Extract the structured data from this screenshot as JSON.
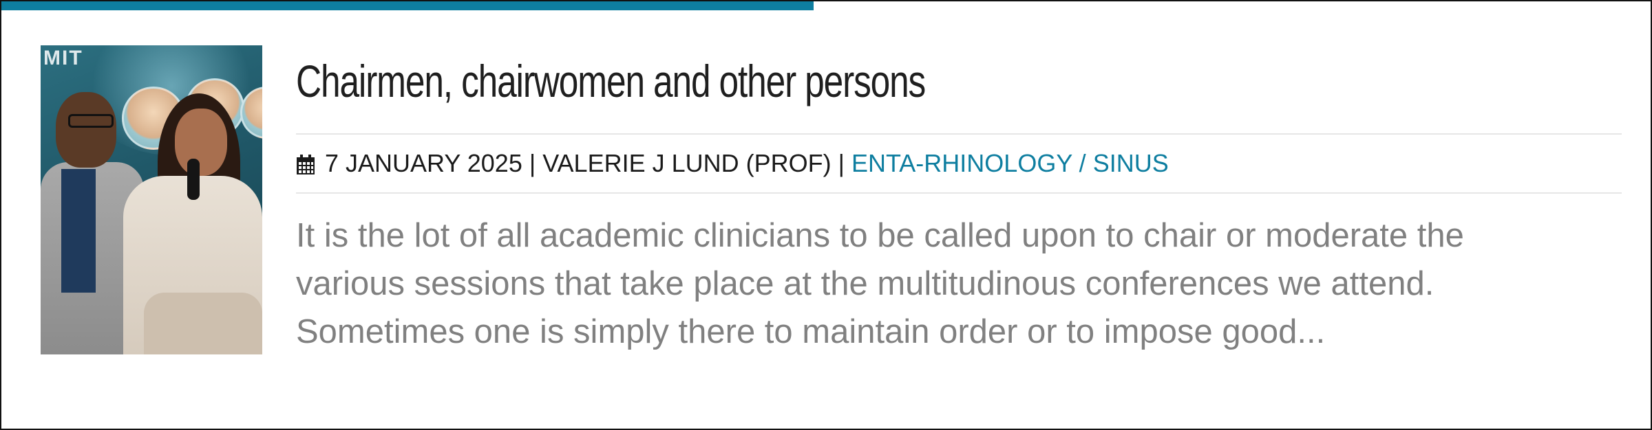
{
  "article": {
    "title": "Chairmen, chairwomen and other persons",
    "date": "7 JANUARY 2025",
    "author": "VALERIE J LUND (PROF)",
    "separator": "|",
    "category": "ENTA-RHINOLOGY / SINUS",
    "excerpt_lines": [
      "It is the lot of all academic clinicians to be called upon to chair or moderate the",
      "various sessions that take place at the multitudinous conferences we attend.",
      "Sometimes one is simply there to maintain order or to impose good..."
    ],
    "thumbnail": {
      "stage_text": "MIT"
    }
  },
  "icons": {
    "date": "calendar-icon"
  },
  "colors": {
    "accent": "#0e7ea0",
    "title": "#1f1f1f",
    "meta": "#1a1a1a",
    "excerpt": "#808080",
    "border": "#111111"
  }
}
